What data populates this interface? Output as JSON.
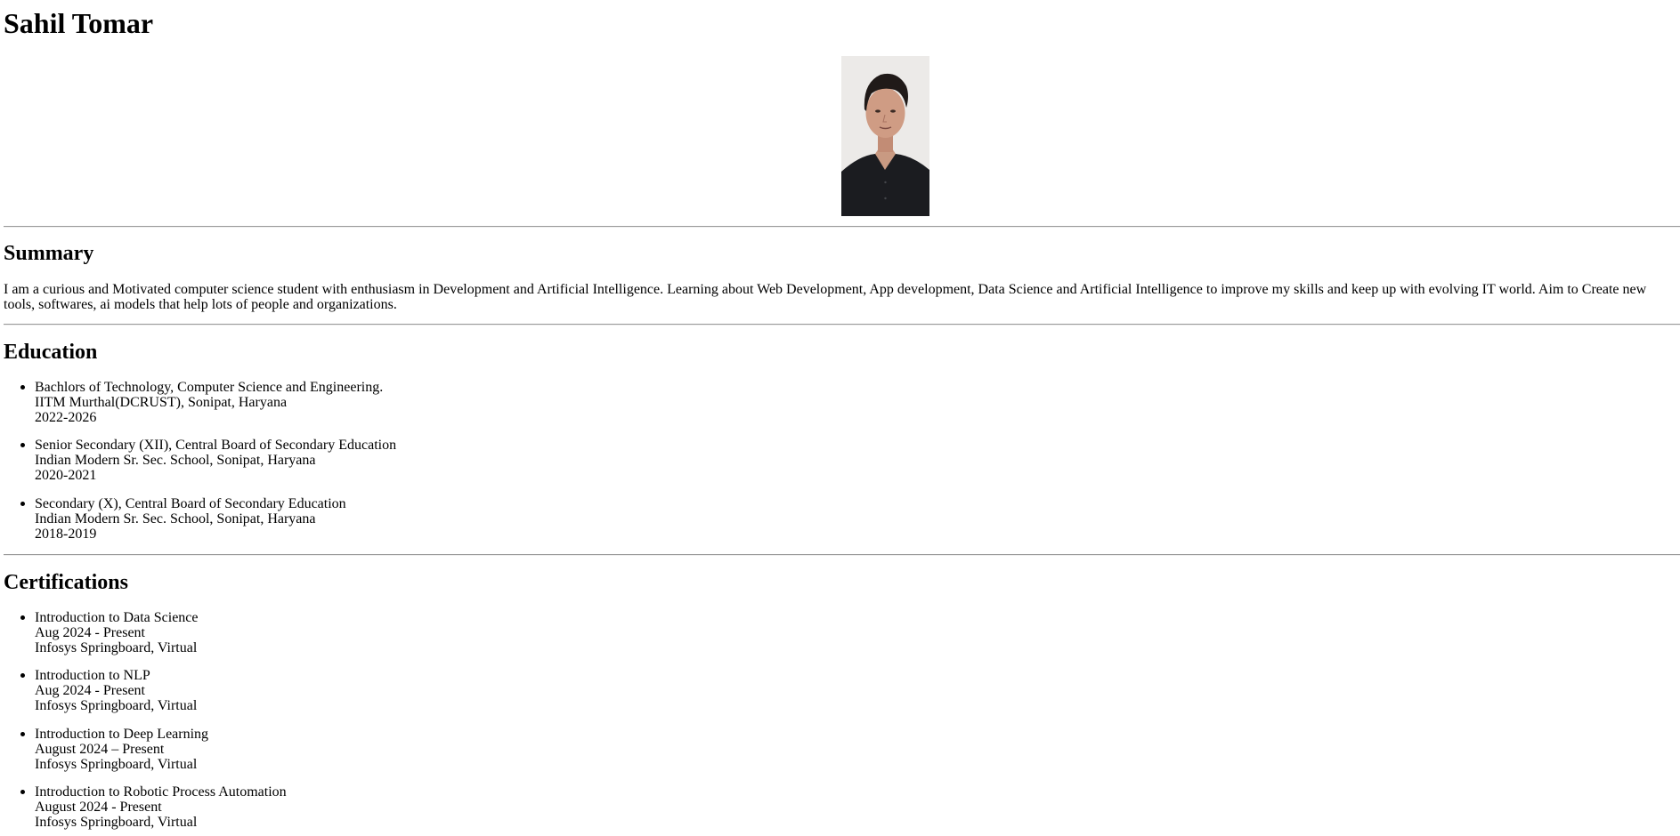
{
  "name": "Sahil Tomar",
  "photo_alt": "Portrait photo",
  "summary": {
    "heading": "Summary",
    "text": "I am a curious and Motivated computer science student with enthusiasm in Development and Artificial Intelligence. Learning about Web Development, App development, Data Science and Artificial Intelligence to improve my skills and keep up with evolving IT world. Aim to Create new tools, softwares, ai models that help lots of people and organizations."
  },
  "education": {
    "heading": "Education",
    "items": [
      {
        "line1": "Bachlors of Technology, Computer Science and Engineering.",
        "line2": "IITM Murthal(DCRUST), Sonipat, Haryana",
        "line3": "2022-2026"
      },
      {
        "line1": "Senior Secondary (XII), Central Board of Secondary Education",
        "line2": "Indian Modern Sr. Sec. School, Sonipat, Haryana",
        "line3": "2020-2021"
      },
      {
        "line1": "Secondary (X), Central Board of Secondary Education",
        "line2": "Indian Modern Sr. Sec. School, Sonipat, Haryana",
        "line3": "2018-2019"
      }
    ]
  },
  "certifications": {
    "heading": "Certifications",
    "items": [
      {
        "line1": "Introduction to Data Science",
        "line2": "Aug 2024 - Present",
        "line3": "Infosys Springboard, Virtual"
      },
      {
        "line1": "Introduction to NLP",
        "line2": "Aug 2024 - Present",
        "line3": "Infosys Springboard, Virtual"
      },
      {
        "line1": "Introduction to Deep Learning",
        "line2": "August 2024 – Present",
        "line3": "Infosys Springboard, Virtual"
      },
      {
        "line1": "Introduction to Robotic Process Automation",
        "line2": "August 2024 - Present",
        "line3": "Infosys Springboard, Virtual"
      }
    ]
  }
}
